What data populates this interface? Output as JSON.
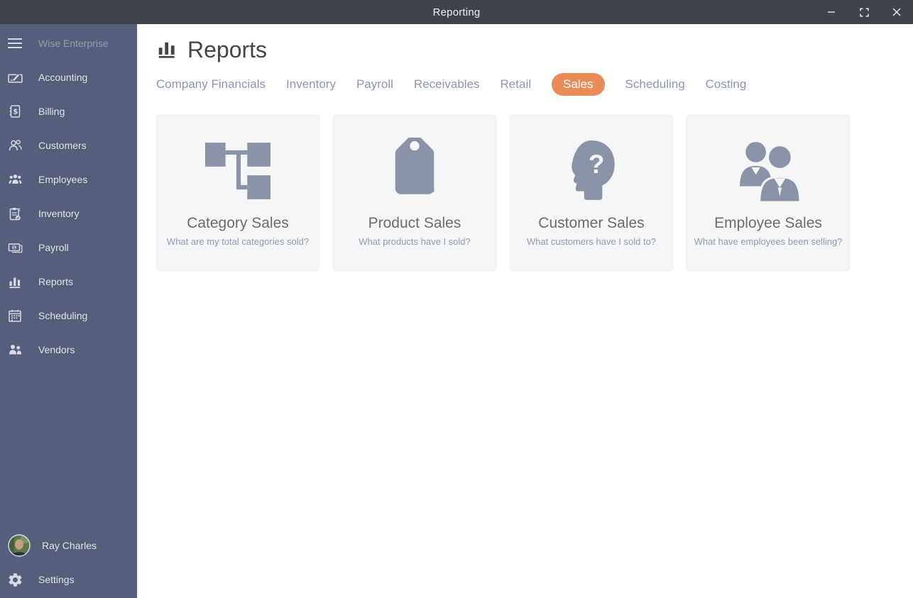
{
  "colors": {
    "accent": "#EA8C57",
    "titlebar_bg": "#3F434B",
    "sidebar_bg": "#555E7B",
    "card_icon_gray": "#8A93A8"
  },
  "titlebar": {
    "title": "Reporting"
  },
  "sidebar": {
    "brand": "Wise Enterprise",
    "items": [
      {
        "label": "Accounting",
        "icon": "accounting-icon"
      },
      {
        "label": "Billing",
        "icon": "billing-icon"
      },
      {
        "label": "Customers",
        "icon": "customers-icon"
      },
      {
        "label": "Employees",
        "icon": "employees-icon"
      },
      {
        "label": "Inventory",
        "icon": "inventory-icon"
      },
      {
        "label": "Payroll",
        "icon": "payroll-icon"
      },
      {
        "label": "Reports",
        "icon": "reports-icon"
      },
      {
        "label": "Scheduling",
        "icon": "scheduling-icon"
      },
      {
        "label": "Vendors",
        "icon": "vendors-icon"
      }
    ],
    "user": {
      "name": "Ray Charles"
    },
    "settings_label": "Settings"
  },
  "main": {
    "title": "Reports",
    "tabs": [
      {
        "label": "Company Financials",
        "active": false
      },
      {
        "label": "Inventory",
        "active": false
      },
      {
        "label": "Payroll",
        "active": false
      },
      {
        "label": "Receivables",
        "active": false
      },
      {
        "label": "Retail",
        "active": false
      },
      {
        "label": "Sales",
        "active": true
      },
      {
        "label": "Scheduling",
        "active": false
      },
      {
        "label": "Costing",
        "active": false
      }
    ],
    "cards": [
      {
        "title": "Category Sales",
        "subtitle": "What are my total categories sold?",
        "icon": "category-hierarchy-icon"
      },
      {
        "title": "Product Sales",
        "subtitle": "What products have I sold?",
        "icon": "price-tag-icon"
      },
      {
        "title": "Customer Sales",
        "subtitle": "What customers have I sold to?",
        "icon": "customer-head-question-icon"
      },
      {
        "title": "Employee Sales",
        "subtitle": "What have employees been selling?",
        "icon": "employees-group-icon"
      }
    ]
  }
}
